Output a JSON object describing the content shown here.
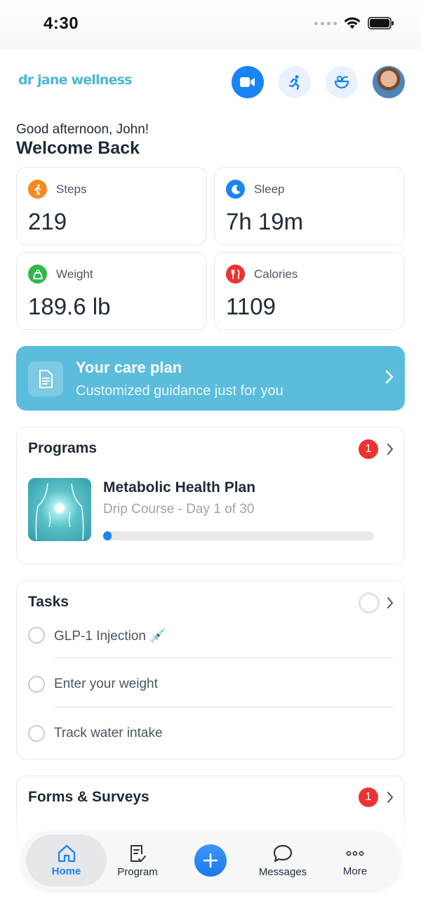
{
  "status_bar": {
    "time": "4:30"
  },
  "header": {
    "logo": "dr jane wellness",
    "icons": [
      "video-call-icon",
      "running-icon",
      "food-bowl-icon",
      "avatar"
    ]
  },
  "greeting": {
    "line1": "Good afternoon, John!",
    "line2": "Welcome Back"
  },
  "stats": [
    {
      "label": "Steps",
      "value": "219",
      "icon": "walking-icon",
      "color": "#f5891f"
    },
    {
      "label": "Sleep",
      "value": "7h 19m",
      "icon": "moon-icon",
      "color": "#1a84f5"
    },
    {
      "label": "Weight",
      "value": "189.6 lb",
      "icon": "scale-weight-icon",
      "color": "#2fb84a"
    },
    {
      "label": "Calories",
      "value": "1109",
      "icon": "fork-knife-icon",
      "color": "#ef3131"
    }
  ],
  "care_plan": {
    "title": "Your care plan",
    "subtitle": "Customized guidance just for you"
  },
  "programs": {
    "title": "Programs",
    "badge": "1",
    "item": {
      "name": "Metabolic Health Plan",
      "subtitle": "Drip Course - Day 1 of 30",
      "progress": 0.03
    }
  },
  "tasks": {
    "title": "Tasks",
    "items": [
      {
        "label": "GLP-1 Injection 💉"
      },
      {
        "label": "Enter your weight"
      },
      {
        "label": "Track water intake"
      }
    ]
  },
  "forms": {
    "title": "Forms & Surveys",
    "badge": "1"
  },
  "tabbar": {
    "items": [
      {
        "label": "Home",
        "icon": "home-icon"
      },
      {
        "label": "Program",
        "icon": "clipboard-check-icon"
      },
      {
        "label": "",
        "icon": "plus-icon"
      },
      {
        "label": "Messages",
        "icon": "chat-bubble-icon"
      },
      {
        "label": "More",
        "icon": "more-dots-icon"
      }
    ]
  },
  "colors": {
    "accent": "#1a84f5",
    "care_plan_bg": "#5bbcdc",
    "badge": "#ef3131",
    "logo": "#4fb6d3"
  }
}
